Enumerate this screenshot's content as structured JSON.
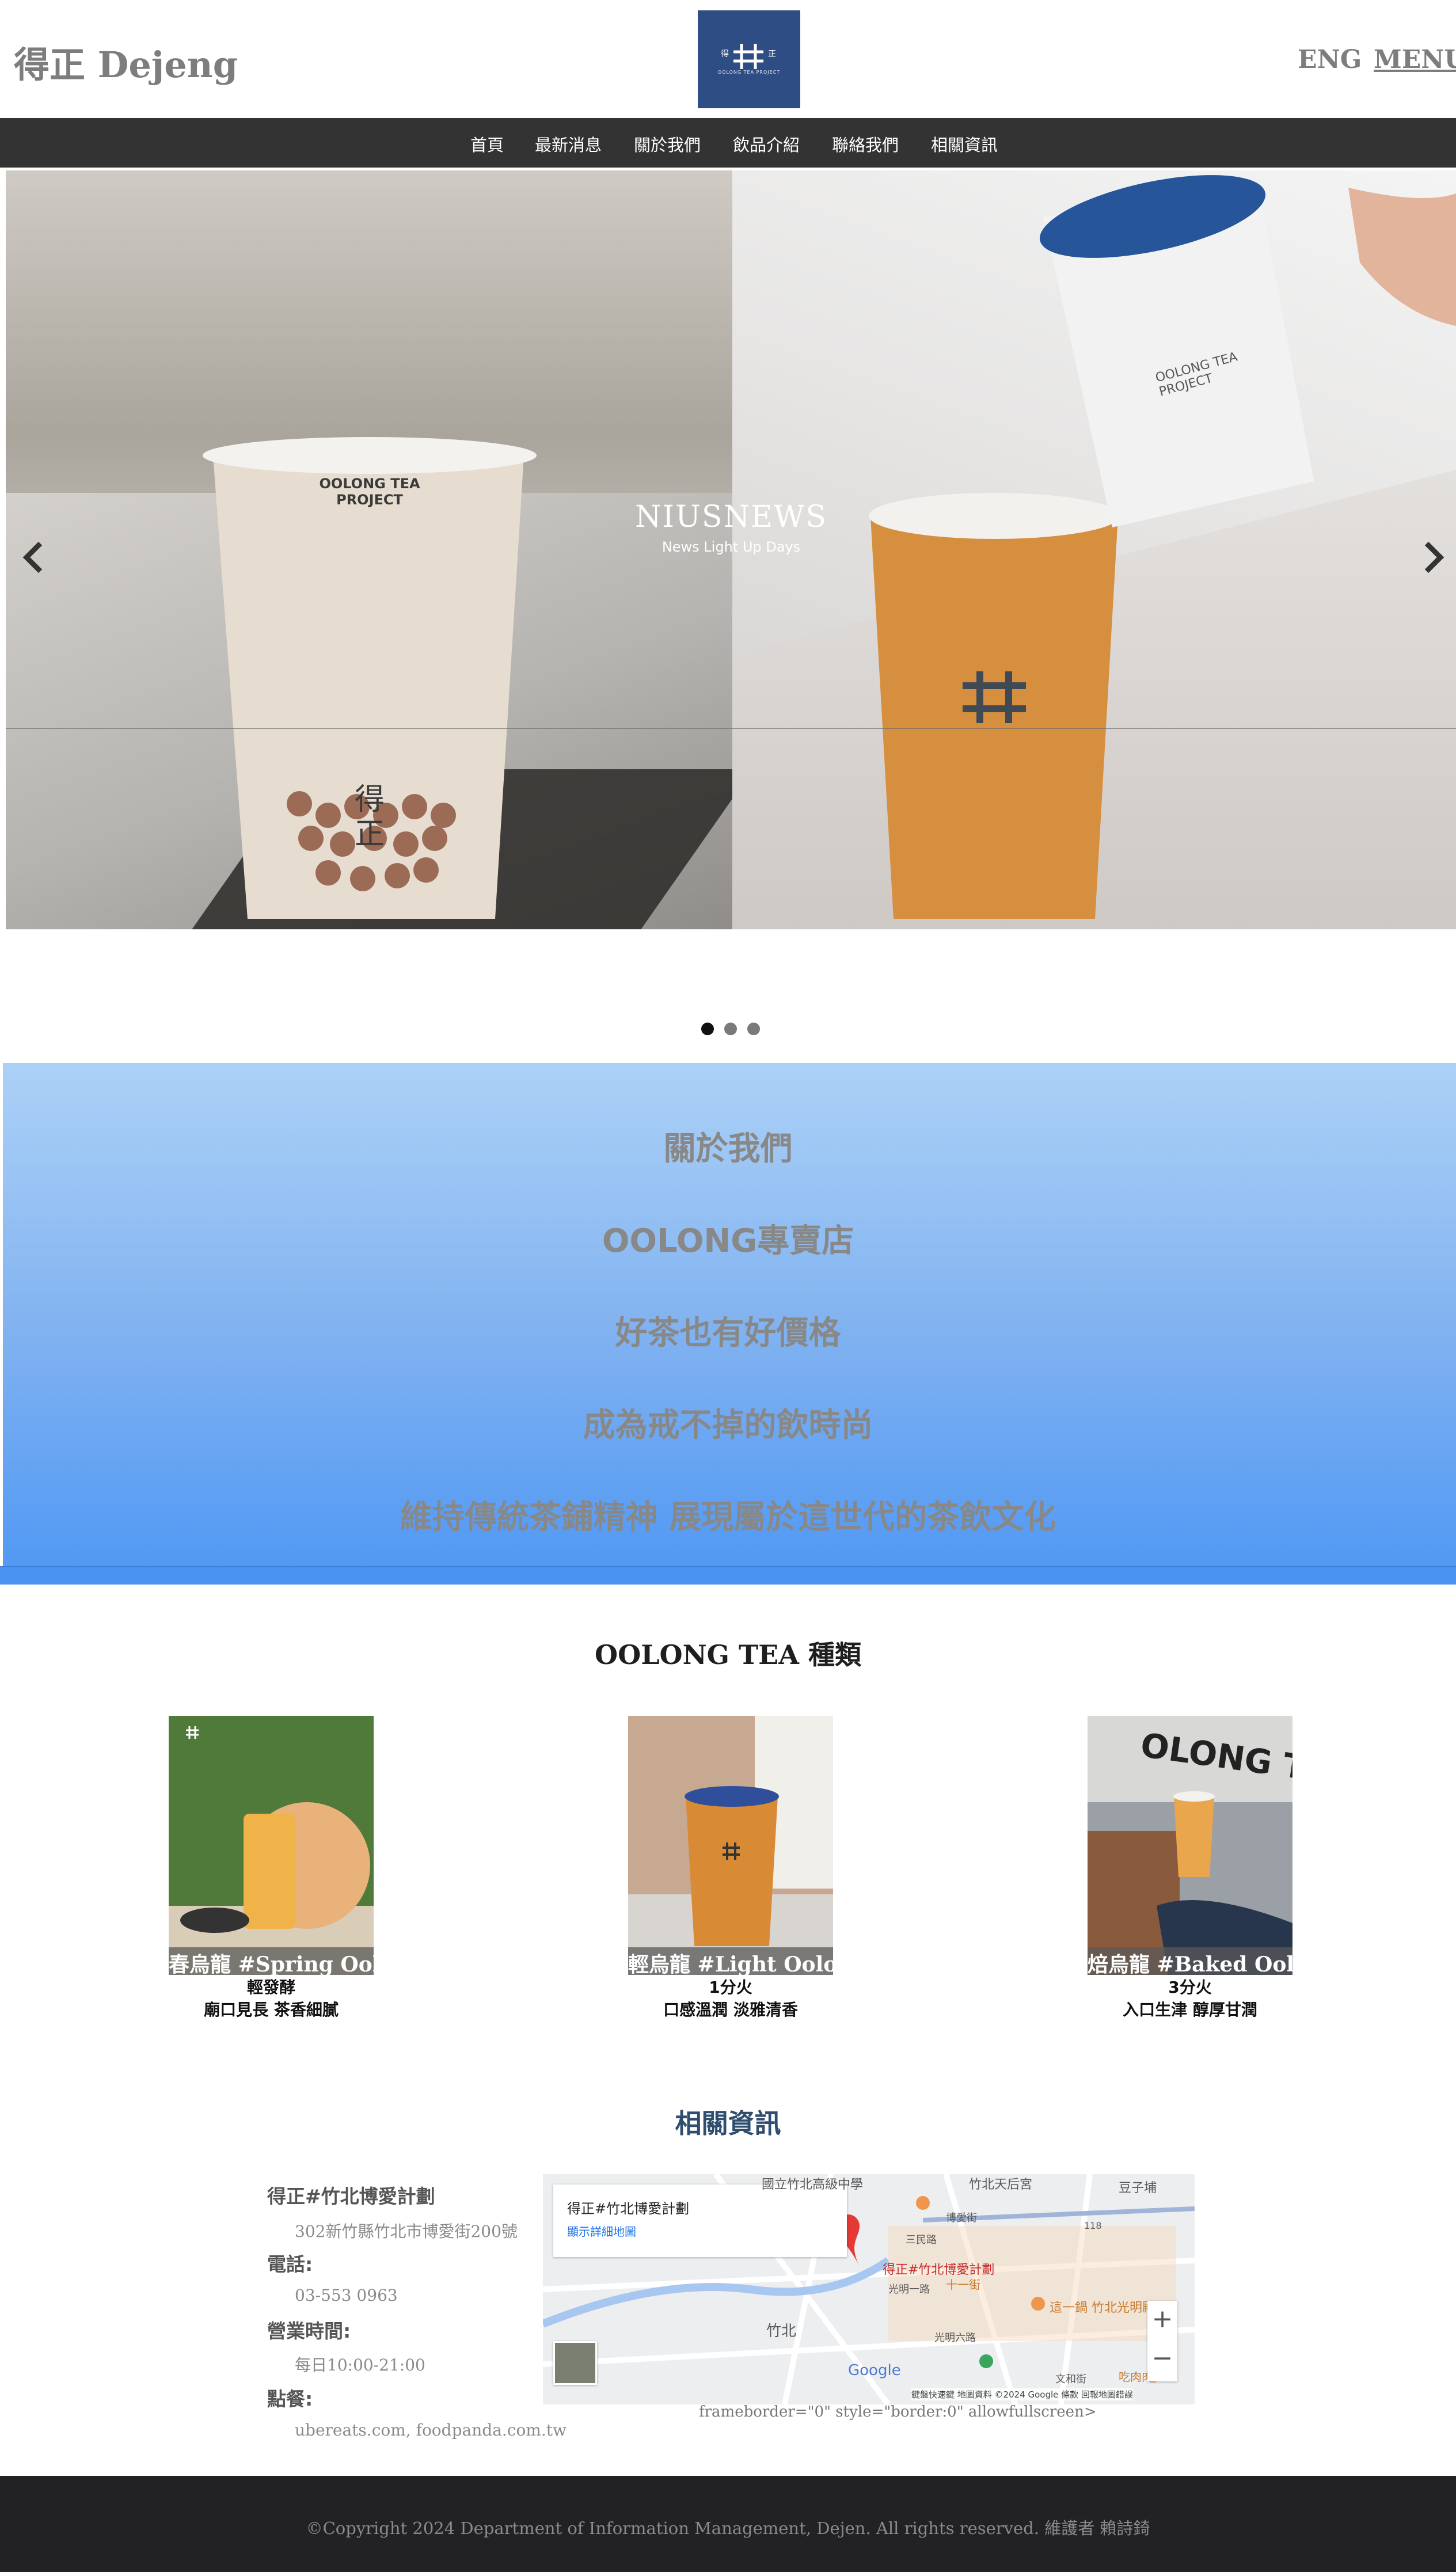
{
  "header": {
    "brand": "得正 Dejeng",
    "logo_left": "得",
    "logo_right": "正",
    "logo_sub": "OOLONG TEA PROJECT",
    "lang": "ENG",
    "menu": "MENU"
  },
  "nav": {
    "items": [
      "首頁",
      "最新消息",
      "關於我們",
      "飲品介紹",
      "聯絡我們",
      "相關資訊"
    ]
  },
  "slider": {
    "watermark": "NIUSNEWS",
    "tagline": "News Light Up Days",
    "left_cup_text": "OOLONG TEA PROJECT",
    "right_cup_text": "OOLONG TEA PROJECT",
    "active_dot": 0,
    "dot_count": 3
  },
  "about": {
    "title": "關於我們",
    "lines": [
      "OOLONG專賣店",
      "好茶也有好價格",
      "成為戒不掉的飲時尚",
      "維持傳統茶鋪精神 展現屬於這世代的茶飲文化"
    ]
  },
  "teas": {
    "title": "OOLONG TEA 種類",
    "items": [
      {
        "name": "春烏龍 #Spring Oolong",
        "level": "輕發酵",
        "desc": "廟口見長 茶香細膩"
      },
      {
        "name": "輕烏龍 #Light Oolong",
        "level": "1分火",
        "desc": "口感溫潤 淡雅清香"
      },
      {
        "name": "焙烏龍 #Baked Oolong",
        "level": "3分火",
        "desc": "入口生津 醇厚甘潤"
      }
    ]
  },
  "info": {
    "title": "相關資訊",
    "store_name": "得正#竹北博愛計劃",
    "address": "302新竹縣竹北市博愛街200號",
    "phone_label": "電話:",
    "phone": "03-553 0963",
    "hours_label": "營業時間:",
    "hours": "每日10:00-21:00",
    "delivery_label": "點餐:",
    "delivery": "ubereats.com, foodpanda.com.tw",
    "iframe_leak": "frameborder=\"0\" style=\"border:0\" allowfullscreen>"
  },
  "map": {
    "card_title": "得正#竹北博愛計劃",
    "card_link": "顯示詳細地圖",
    "pin_label": "得正#竹北博愛計劃",
    "places": [
      "竹北天后宮",
      "豆子埔",
      "國立竹北高級中學",
      "博愛街",
      "三民路",
      "光明一路",
      "十一街",
      "這一鍋 竹北光明殿",
      "竹北",
      "光明六路",
      "吃肉肉",
      "文和街",
      "118"
    ],
    "google": "Google",
    "footer": "鍵盤快速鍵  地圖資料 ©2024 Google  條款  回報地圖錯誤",
    "zoom_in": "+",
    "zoom_out": "−"
  },
  "footer": {
    "copyright": "©Copyright 2024 Department of Information Management, Dejen. All rights reserved. 維護者 賴詩錡"
  }
}
